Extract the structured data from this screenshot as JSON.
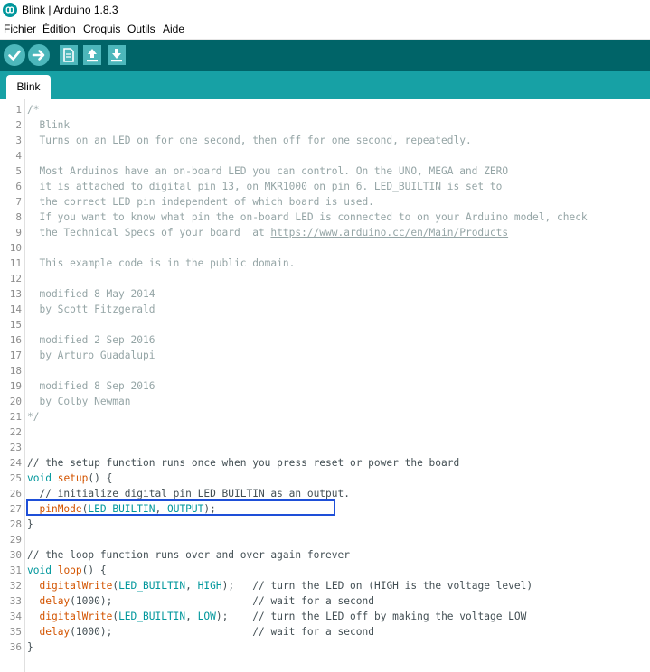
{
  "window": {
    "title": "Blink | Arduino 1.8.3",
    "icon": "arduino-logo-icon"
  },
  "menubar": {
    "items": [
      "Fichier",
      "Édition",
      "Croquis",
      "Outils",
      "Aide"
    ]
  },
  "toolbar": {
    "buttons": [
      "verify-icon",
      "upload-icon",
      "new-icon",
      "open-icon",
      "save-icon"
    ]
  },
  "tabs": [
    {
      "label": "Blink",
      "active": true
    }
  ],
  "colors": {
    "toolbar": "#006468",
    "tabbar": "#17a1a5",
    "button": "#4db7bb",
    "highlight_box": "#1e4fd8"
  },
  "editor": {
    "line_numbers": [
      "1",
      "2",
      "3",
      "4",
      "5",
      "6",
      "7",
      "8",
      "9",
      "10",
      "11",
      "12",
      "13",
      "14",
      "15",
      "16",
      "17",
      "18",
      "19",
      "20",
      "21",
      "22",
      "23",
      "24",
      "25",
      "26",
      "27",
      "28",
      "29",
      "30",
      "31",
      "32",
      "33",
      "34",
      "35",
      "36"
    ],
    "lines": [
      [
        {
          "t": "/*",
          "c": "comment"
        }
      ],
      [
        {
          "t": "  Blink",
          "c": "comment"
        }
      ],
      [
        {
          "t": "  Turns on an LED on for one second, then off for one second, repeatedly.",
          "c": "comment"
        }
      ],
      [
        {
          "t": "",
          "c": "comment"
        }
      ],
      [
        {
          "t": "  Most Arduinos have an on-board LED you can control. On the UNO, MEGA and ZERO",
          "c": "comment"
        }
      ],
      [
        {
          "t": "  it is attached to digital pin 13, on MKR1000 on pin 6. LED_BUILTIN is set to",
          "c": "comment"
        }
      ],
      [
        {
          "t": "  the correct LED pin independent of which board is used.",
          "c": "comment"
        }
      ],
      [
        {
          "t": "  If you want to know what pin the on-board LED is connected to on your Arduino model, check",
          "c": "comment"
        }
      ],
      [
        {
          "t": "  the Technical Specs of your board  at ",
          "c": "comment"
        },
        {
          "t": "https://www.arduino.cc/en/Main/Products",
          "c": "link"
        }
      ],
      [
        {
          "t": "",
          "c": "comment"
        }
      ],
      [
        {
          "t": "  This example code is in the public domain.",
          "c": "comment"
        }
      ],
      [
        {
          "t": "",
          "c": "comment"
        }
      ],
      [
        {
          "t": "  modified 8 May 2014",
          "c": "comment"
        }
      ],
      [
        {
          "t": "  by Scott Fitzgerald",
          "c": "comment"
        }
      ],
      [
        {
          "t": "",
          "c": "comment"
        }
      ],
      [
        {
          "t": "  modified 2 Sep 2016",
          "c": "comment"
        }
      ],
      [
        {
          "t": "  by Arturo Guadalupi",
          "c": "comment"
        }
      ],
      [
        {
          "t": "",
          "c": "comment"
        }
      ],
      [
        {
          "t": "  modified 8 Sep 2016",
          "c": "comment"
        }
      ],
      [
        {
          "t": "  by Colby Newman",
          "c": "comment"
        }
      ],
      [
        {
          "t": "*/",
          "c": "comment"
        }
      ],
      [],
      [],
      [
        {
          "t": "// the setup function runs once when you press reset or power the board",
          "c": "plain"
        }
      ],
      [
        {
          "t": "void",
          "c": "type"
        },
        {
          "t": " ",
          "c": "plain"
        },
        {
          "t": "setup",
          "c": "func"
        },
        {
          "t": "() {",
          "c": "plain"
        }
      ],
      [
        {
          "t": "  // initialize digital pin LED_BUILTIN as an output.",
          "c": "plain"
        }
      ],
      [
        {
          "t": "  ",
          "c": "plain"
        },
        {
          "t": "pinMode",
          "c": "func"
        },
        {
          "t": "(",
          "c": "plain"
        },
        {
          "t": "LED_BUILTIN",
          "c": "const"
        },
        {
          "t": ", ",
          "c": "plain"
        },
        {
          "t": "OUTPUT",
          "c": "const"
        },
        {
          "t": ");",
          "c": "plain"
        }
      ],
      [
        {
          "t": "}",
          "c": "plain"
        }
      ],
      [],
      [
        {
          "t": "// the loop function runs over and over again forever",
          "c": "plain"
        }
      ],
      [
        {
          "t": "void",
          "c": "type"
        },
        {
          "t": " ",
          "c": "plain"
        },
        {
          "t": "loop",
          "c": "func"
        },
        {
          "t": "() {",
          "c": "plain"
        }
      ],
      [
        {
          "t": "  ",
          "c": "plain"
        },
        {
          "t": "digitalWrite",
          "c": "func"
        },
        {
          "t": "(",
          "c": "plain"
        },
        {
          "t": "LED_BUILTIN",
          "c": "const"
        },
        {
          "t": ", ",
          "c": "plain"
        },
        {
          "t": "HIGH",
          "c": "const"
        },
        {
          "t": ");   // turn the LED on (HIGH is the voltage level)",
          "c": "plain"
        }
      ],
      [
        {
          "t": "  ",
          "c": "plain"
        },
        {
          "t": "delay",
          "c": "func"
        },
        {
          "t": "(1000);                       // wait for a second",
          "c": "plain"
        }
      ],
      [
        {
          "t": "  ",
          "c": "plain"
        },
        {
          "t": "digitalWrite",
          "c": "func"
        },
        {
          "t": "(",
          "c": "plain"
        },
        {
          "t": "LED_BUILTIN",
          "c": "const"
        },
        {
          "t": ", ",
          "c": "plain"
        },
        {
          "t": "LOW",
          "c": "const"
        },
        {
          "t": ");    // turn the LED off by making the voltage LOW",
          "c": "plain"
        }
      ],
      [
        {
          "t": "  ",
          "c": "plain"
        },
        {
          "t": "delay",
          "c": "func"
        },
        {
          "t": "(1000);                       // wait for a second",
          "c": "plain"
        }
      ],
      [
        {
          "t": "}",
          "c": "plain"
        }
      ]
    ]
  }
}
